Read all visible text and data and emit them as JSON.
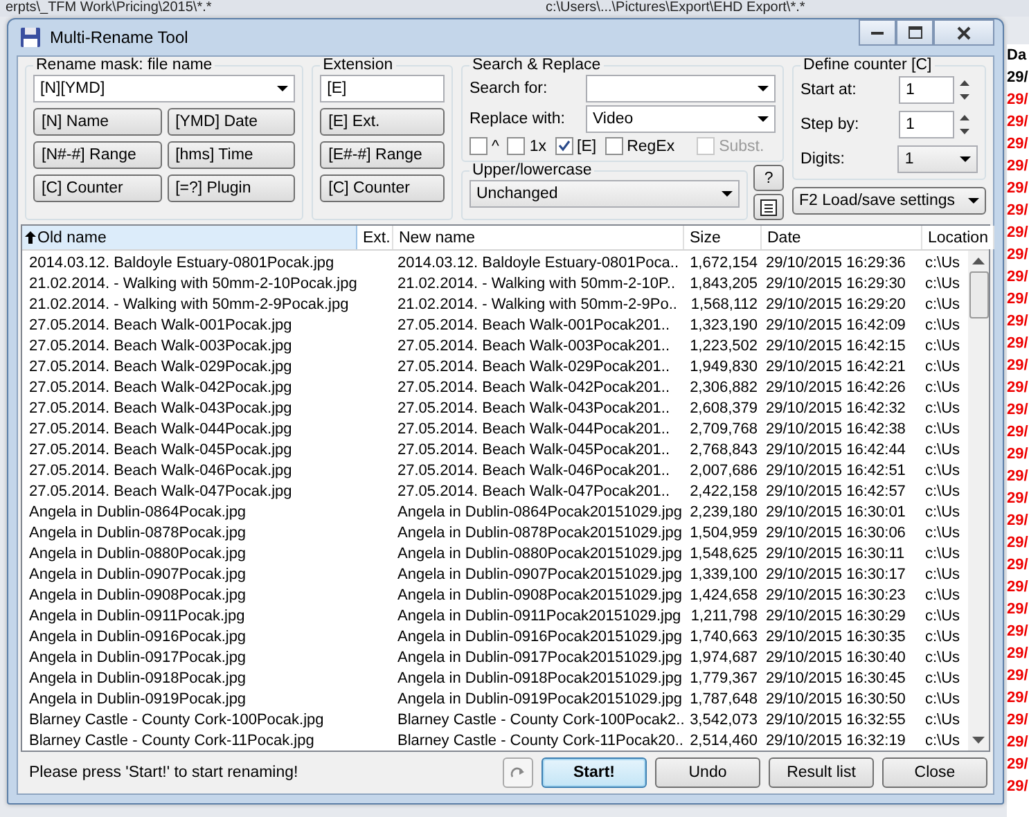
{
  "backdrop": {
    "paths": [
      "erpts\\_TFM Work\\Pricing\\2015\\*.*",
      "c:\\Users\\...\\Pictures\\Export\\EHD Export\\*.*"
    ],
    "column_header": "Da",
    "dates": [
      {
        "text": "29/",
        "color": "#000000"
      },
      {
        "text": "29/",
        "color": "#ee0000"
      },
      {
        "text": "29/",
        "color": "#ee0000"
      },
      {
        "text": "29/",
        "color": "#ee0000"
      },
      {
        "text": "29/",
        "color": "#ee0000"
      },
      {
        "text": "29/",
        "color": "#ee0000"
      },
      {
        "text": "29/",
        "color": "#ee0000"
      },
      {
        "text": "29/",
        "color": "#ee0000"
      },
      {
        "text": "29/",
        "color": "#ee0000"
      },
      {
        "text": "29/",
        "color": "#ee0000"
      },
      {
        "text": "29/",
        "color": "#ee0000"
      },
      {
        "text": "29/",
        "color": "#ee0000"
      },
      {
        "text": "29/",
        "color": "#ee0000"
      },
      {
        "text": "29/",
        "color": "#ee0000"
      },
      {
        "text": "29/",
        "color": "#ee0000"
      },
      {
        "text": "29/",
        "color": "#ee0000"
      },
      {
        "text": "29/",
        "color": "#ee0000"
      },
      {
        "text": "29/",
        "color": "#ee0000"
      },
      {
        "text": "29/",
        "color": "#ee0000"
      },
      {
        "text": "29/",
        "color": "#ee0000"
      },
      {
        "text": "29/",
        "color": "#ee0000"
      },
      {
        "text": "29/",
        "color": "#ee0000"
      },
      {
        "text": "29/",
        "color": "#ee0000"
      },
      {
        "text": "29/",
        "color": "#ee0000"
      },
      {
        "text": "29/",
        "color": "#ee0000"
      },
      {
        "text": "29/",
        "color": "#ee0000"
      },
      {
        "text": "29/",
        "color": "#ee0000"
      },
      {
        "text": "29/",
        "color": "#ee0000"
      },
      {
        "text": "29/",
        "color": "#ee0000"
      },
      {
        "text": "29/",
        "color": "#ee0000"
      },
      {
        "text": "29/",
        "color": "#ee0000"
      },
      {
        "text": "29/",
        "color": "#ee0000"
      },
      {
        "text": "29/",
        "color": "#ee0000"
      }
    ]
  },
  "window": {
    "title": "Multi-Rename Tool"
  },
  "rename_mask": {
    "title": "Rename mask: file name",
    "value": "[N][YMD]",
    "buttons": [
      "[N]  Name",
      "[YMD]  Date",
      "[N#-#] Range",
      "[hms]  Time",
      "[C]  Counter",
      "[=?]  Plugin"
    ]
  },
  "extension": {
    "title": "Extension",
    "value": "[E]",
    "buttons": [
      "[E]  Ext.",
      "[E#-#] Range",
      "[C]  Counter"
    ]
  },
  "search_replace": {
    "title": "Search & Replace",
    "search_label": "Search for:",
    "replace_label": "Replace with:",
    "replace_value": "Video",
    "options": [
      {
        "label": "^",
        "checked": false,
        "disabled": false
      },
      {
        "label": "1x",
        "checked": false,
        "disabled": false
      },
      {
        "label": "[E]",
        "checked": true,
        "disabled": false
      },
      {
        "label": "RegEx",
        "checked": false,
        "disabled": false
      },
      {
        "label": "Subst.",
        "checked": false,
        "disabled": true
      }
    ]
  },
  "case": {
    "title": "Upper/lowercase",
    "value": "Unchanged",
    "help": "?"
  },
  "counter": {
    "title": "Define counter [C]",
    "fields": [
      {
        "kind": "spin",
        "label": "Start at:",
        "value": "1"
      },
      {
        "kind": "spin",
        "label": "Step by:",
        "value": "1"
      },
      {
        "kind": "select",
        "label": "Digits:",
        "value": "1"
      }
    ]
  },
  "settings": "F2 Load/save settings",
  "table": {
    "columns": [
      {
        "label": "Old name",
        "sorted": true
      },
      {
        "label": "Ext.",
        "sorted": false
      },
      {
        "label": "New name",
        "sorted": false
      },
      {
        "label": "Size",
        "sorted": false
      },
      {
        "label": "Date",
        "sorted": false
      },
      {
        "label": "Location",
        "sorted": false
      }
    ],
    "rows": [
      [
        "2014.03.12. Baldoyle Estuary-0801Pocak.jpg",
        "",
        "2014.03.12. Baldoyle Estuary-0801Poca..",
        "1,672,154",
        "29/10/2015 16:29:36",
        "c:\\Us"
      ],
      [
        "21.02.2014. - Walking with 50mm-2-10Pocak.jpg",
        "",
        "21.02.2014. - Walking with 50mm-2-10P..",
        "1,843,205",
        "29/10/2015 16:29:30",
        "c:\\Us"
      ],
      [
        "21.02.2014. - Walking with 50mm-2-9Pocak.jpg",
        "",
        "21.02.2014. - Walking with 50mm-2-9Po..",
        "1,568,112",
        "29/10/2015 16:29:20",
        "c:\\Us"
      ],
      [
        "27.05.2014. Beach Walk-001Pocak.jpg",
        "",
        "27.05.2014. Beach Walk-001Pocak201..",
        "1,323,190",
        "29/10/2015 16:42:09",
        "c:\\Us"
      ],
      [
        "27.05.2014. Beach Walk-003Pocak.jpg",
        "",
        "27.05.2014. Beach Walk-003Pocak201..",
        "1,223,502",
        "29/10/2015 16:42:15",
        "c:\\Us"
      ],
      [
        "27.05.2014. Beach Walk-029Pocak.jpg",
        "",
        "27.05.2014. Beach Walk-029Pocak201..",
        "1,949,830",
        "29/10/2015 16:42:21",
        "c:\\Us"
      ],
      [
        "27.05.2014. Beach Walk-042Pocak.jpg",
        "",
        "27.05.2014. Beach Walk-042Pocak201..",
        "2,306,882",
        "29/10/2015 16:42:26",
        "c:\\Us"
      ],
      [
        "27.05.2014. Beach Walk-043Pocak.jpg",
        "",
        "27.05.2014. Beach Walk-043Pocak201..",
        "2,608,379",
        "29/10/2015 16:42:32",
        "c:\\Us"
      ],
      [
        "27.05.2014. Beach Walk-044Pocak.jpg",
        "",
        "27.05.2014. Beach Walk-044Pocak201..",
        "2,709,768",
        "29/10/2015 16:42:38",
        "c:\\Us"
      ],
      [
        "27.05.2014. Beach Walk-045Pocak.jpg",
        "",
        "27.05.2014. Beach Walk-045Pocak201..",
        "2,768,843",
        "29/10/2015 16:42:44",
        "c:\\Us"
      ],
      [
        "27.05.2014. Beach Walk-046Pocak.jpg",
        "",
        "27.05.2014. Beach Walk-046Pocak201..",
        "2,007,686",
        "29/10/2015 16:42:51",
        "c:\\Us"
      ],
      [
        "27.05.2014. Beach Walk-047Pocak.jpg",
        "",
        "27.05.2014. Beach Walk-047Pocak201..",
        "2,422,158",
        "29/10/2015 16:42:57",
        "c:\\Us"
      ],
      [
        "Angela in Dublin-0864Pocak.jpg",
        "",
        "Angela in Dublin-0864Pocak20151029.jpg",
        "2,239,180",
        "29/10/2015 16:30:01",
        "c:\\Us"
      ],
      [
        "Angela in Dublin-0878Pocak.jpg",
        "",
        "Angela in Dublin-0878Pocak20151029.jpg",
        "1,504,959",
        "29/10/2015 16:30:06",
        "c:\\Us"
      ],
      [
        "Angela in Dublin-0880Pocak.jpg",
        "",
        "Angela in Dublin-0880Pocak20151029.jpg",
        "1,548,625",
        "29/10/2015 16:30:11",
        "c:\\Us"
      ],
      [
        "Angela in Dublin-0907Pocak.jpg",
        "",
        "Angela in Dublin-0907Pocak20151029.jpg",
        "1,339,100",
        "29/10/2015 16:30:17",
        "c:\\Us"
      ],
      [
        "Angela in Dublin-0908Pocak.jpg",
        "",
        "Angela in Dublin-0908Pocak20151029.jpg",
        "1,424,658",
        "29/10/2015 16:30:23",
        "c:\\Us"
      ],
      [
        "Angela in Dublin-0911Pocak.jpg",
        "",
        "Angela in Dublin-0911Pocak20151029.jpg",
        "1,211,798",
        "29/10/2015 16:30:29",
        "c:\\Us"
      ],
      [
        "Angela in Dublin-0916Pocak.jpg",
        "",
        "Angela in Dublin-0916Pocak20151029.jpg",
        "1,740,663",
        "29/10/2015 16:30:35",
        "c:\\Us"
      ],
      [
        "Angela in Dublin-0917Pocak.jpg",
        "",
        "Angela in Dublin-0917Pocak20151029.jpg",
        "1,974,687",
        "29/10/2015 16:30:40",
        "c:\\Us"
      ],
      [
        "Angela in Dublin-0918Pocak.jpg",
        "",
        "Angela in Dublin-0918Pocak20151029.jpg",
        "1,779,367",
        "29/10/2015 16:30:45",
        "c:\\Us"
      ],
      [
        "Angela in Dublin-0919Pocak.jpg",
        "",
        "Angela in Dublin-0919Pocak20151029.jpg",
        "1,787,648",
        "29/10/2015 16:30:50",
        "c:\\Us"
      ],
      [
        "Blarney Castle - County Cork-100Pocak.jpg",
        "",
        "Blarney Castle - County Cork-100Pocak2..",
        "3,542,073",
        "29/10/2015 16:32:55",
        "c:\\Us"
      ],
      [
        "Blarney Castle - County Cork-11Pocak.jpg",
        "",
        "Blarney Castle - County Cork-11Pocak20..",
        "2,514,460",
        "29/10/2015 16:32:19",
        "c:\\Us"
      ]
    ]
  },
  "status": "Please press 'Start!' to start renaming!",
  "buttons": [
    {
      "label": "Start!",
      "default": true
    },
    {
      "label": "Undo",
      "default": false
    },
    {
      "label": "Result list",
      "default": false
    },
    {
      "label": "Close",
      "default": false
    }
  ]
}
